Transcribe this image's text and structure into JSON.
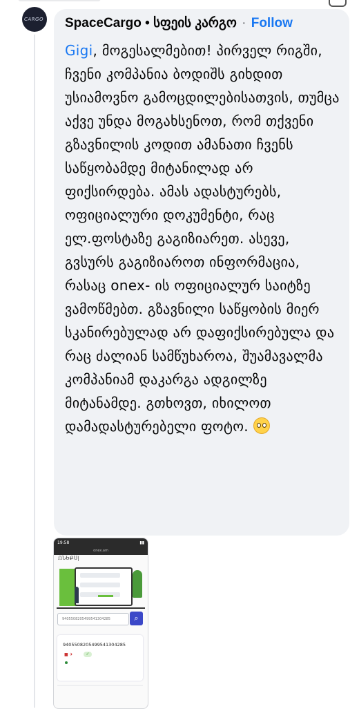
{
  "comment": {
    "author": "SpaceCargo • სფეის კარგო",
    "separator": "·",
    "follow_label": "Follow",
    "mention": "Gigi",
    "text": ", მოგესალმებით! პირველ რიგში, ჩვენი კომპანია ბოდიშს გიხდით უსიამოვნო გამოცდილებისათვის, თუმცა აქვე უნდა მოგახსენოთ, რომ თქვენი გზავნილის კოდით ამანათი ჩვენს საწყობამდე მიტანილად არ ფიქსირდება. ამას ადასტურებს, ოფიციალური დოკუმენტი, რაც ელ.ფოსტაზე გაგიზიარეთ. ასევე, გვსურს გაგიზიაროთ ინფორმაცია, რასაც onex- ის ოფიციალურ საიტზე ვამოწმებთ. გზავნილი საწყობის მიერ სკანირებულად არ დაფიქსირებულა და რაც ძალიან სამწუხაროა, შუამავალმა კომპანიამ დაკარგა ადგილზე მიტანამდე. გთხოვთ, იხილოთ დამადასტურებელი ფოტო.",
    "emoji": "pleading-face-icon"
  },
  "avatar": {
    "label": "CARGO"
  },
  "attachment": {
    "status_time": "19:58",
    "url": "onex.am",
    "page_title": "ՈՆԵՔՍ|",
    "search_value": "9405508205499541304285",
    "tracking_number": "9405508205499541304285",
    "search_icon": "search-icon",
    "check_icon": "check-icon"
  },
  "colors": {
    "link": "#1877f2",
    "bubble": "#f0f2f5",
    "button": "#3b48c8"
  }
}
